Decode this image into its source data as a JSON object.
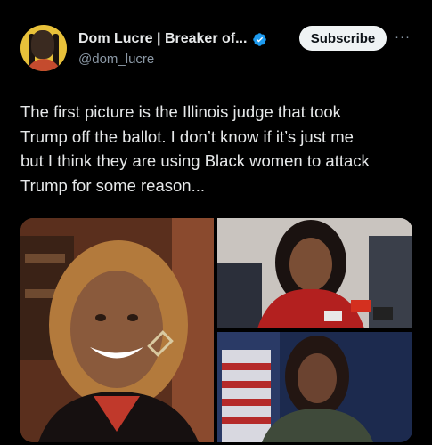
{
  "author": {
    "display_name": "Dom Lucre | Breaker of...",
    "handle": "@dom_lucre",
    "avatar_icon": "profile-avatar",
    "verified_icon": "verified-badge-icon"
  },
  "actions": {
    "subscribe_label": "Subscribe",
    "more_label": "···"
  },
  "tweet": {
    "text": "The first picture is the Illinois judge that took\nTrump off the ballot. I don’t know if it’s just me\nbut I think they are using Black women to attack\nTrump for some reason..."
  },
  "media": {
    "count": 3
  },
  "colors": {
    "background": "#000000",
    "text": "#e7e9ea",
    "muted": "#8b98a5",
    "verified": "#1d9bf0",
    "subscribe_bg": "#eff3f4"
  }
}
